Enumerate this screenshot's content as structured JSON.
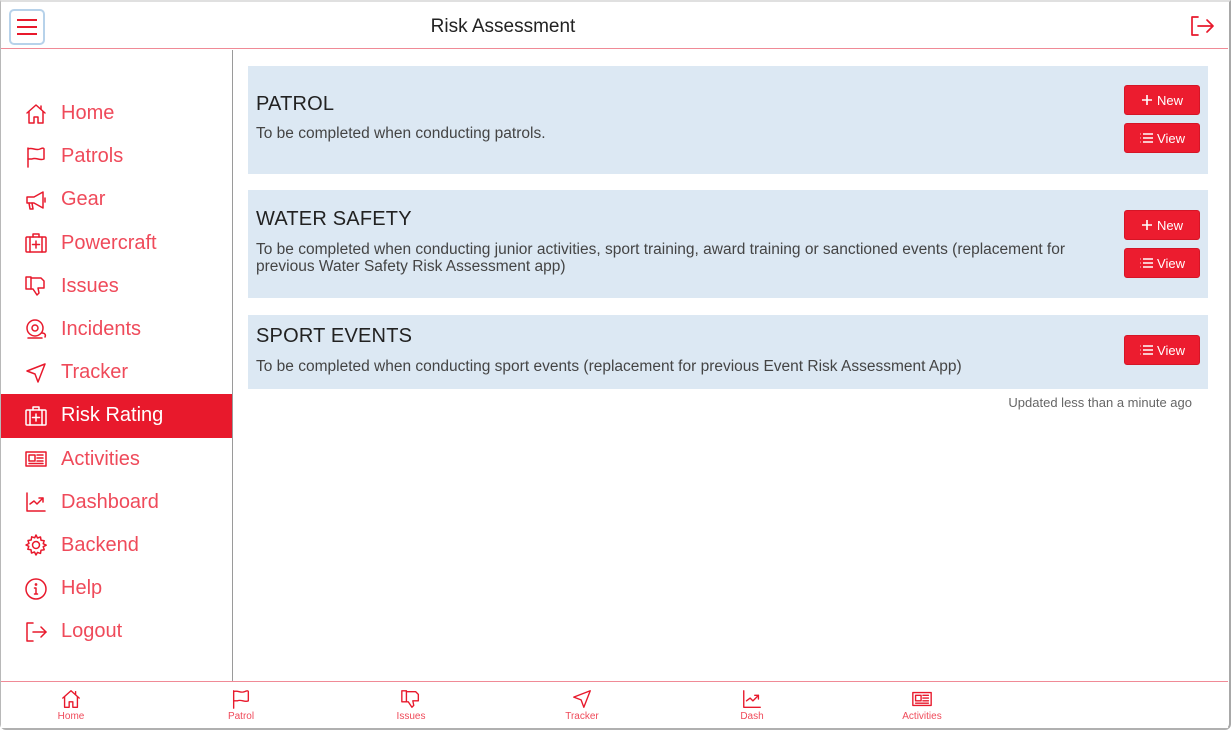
{
  "header": {
    "title": "Risk Assessment",
    "menu_icon": "hamburger-icon",
    "exit_icon": "logout-icon"
  },
  "colors": {
    "accent": "#e8192c",
    "card_bg": "#dce8f3",
    "menu_border": "#b7d2ea"
  },
  "sidebar": {
    "items": [
      {
        "label": "Home",
        "icon": "home-icon",
        "active": false
      },
      {
        "label": "Patrols",
        "icon": "flag-icon",
        "active": false
      },
      {
        "label": "Gear",
        "icon": "megaphone-icon",
        "active": false
      },
      {
        "label": "Powercraft",
        "icon": "first-aid-kit-icon",
        "active": false
      },
      {
        "label": "Issues",
        "icon": "thumbs-down-icon",
        "active": false
      },
      {
        "label": "Incidents",
        "icon": "alarm-bell-icon",
        "active": false
      },
      {
        "label": "Tracker",
        "icon": "navigation-arrow-icon",
        "active": false
      },
      {
        "label": "Risk Rating",
        "icon": "first-aid-kit-icon",
        "active": true
      },
      {
        "label": "Activities",
        "icon": "newspaper-icon",
        "active": false
      },
      {
        "label": "Dashboard",
        "icon": "trending-chart-icon",
        "active": false
      },
      {
        "label": "Backend",
        "icon": "gear-icon",
        "active": false
      },
      {
        "label": "Help",
        "icon": "info-icon",
        "active": false
      },
      {
        "label": "Logout",
        "icon": "logout-icon",
        "active": false
      }
    ]
  },
  "main": {
    "cards": [
      {
        "title": "PATROL",
        "description": "To be completed when conducting patrols.",
        "new_label": "New",
        "view_label": "View"
      },
      {
        "title": "WATER SAFETY",
        "description": "To be completed when conducting junior activities, sport training, award training or sanctioned events (replacement for previous Water Safety Risk Assessment app)",
        "new_label": "New",
        "view_label": "View"
      },
      {
        "title": "SPORT EVENTS",
        "description": "To be completed when conducting sport events (replacement for previous Event Risk Assessment App)",
        "view_label": "View"
      }
    ],
    "updated_text": "Updated less than a minute ago"
  },
  "footer": {
    "tabs": [
      {
        "label": "Home",
        "icon": "home-icon"
      },
      {
        "label": "Patrol",
        "icon": "flag-icon"
      },
      {
        "label": "Issues",
        "icon": "thumbs-down-icon"
      },
      {
        "label": "Tracker",
        "icon": "navigation-arrow-icon"
      },
      {
        "label": "Dash",
        "icon": "trending-chart-icon"
      },
      {
        "label": "Activities",
        "icon": "newspaper-icon"
      }
    ]
  }
}
